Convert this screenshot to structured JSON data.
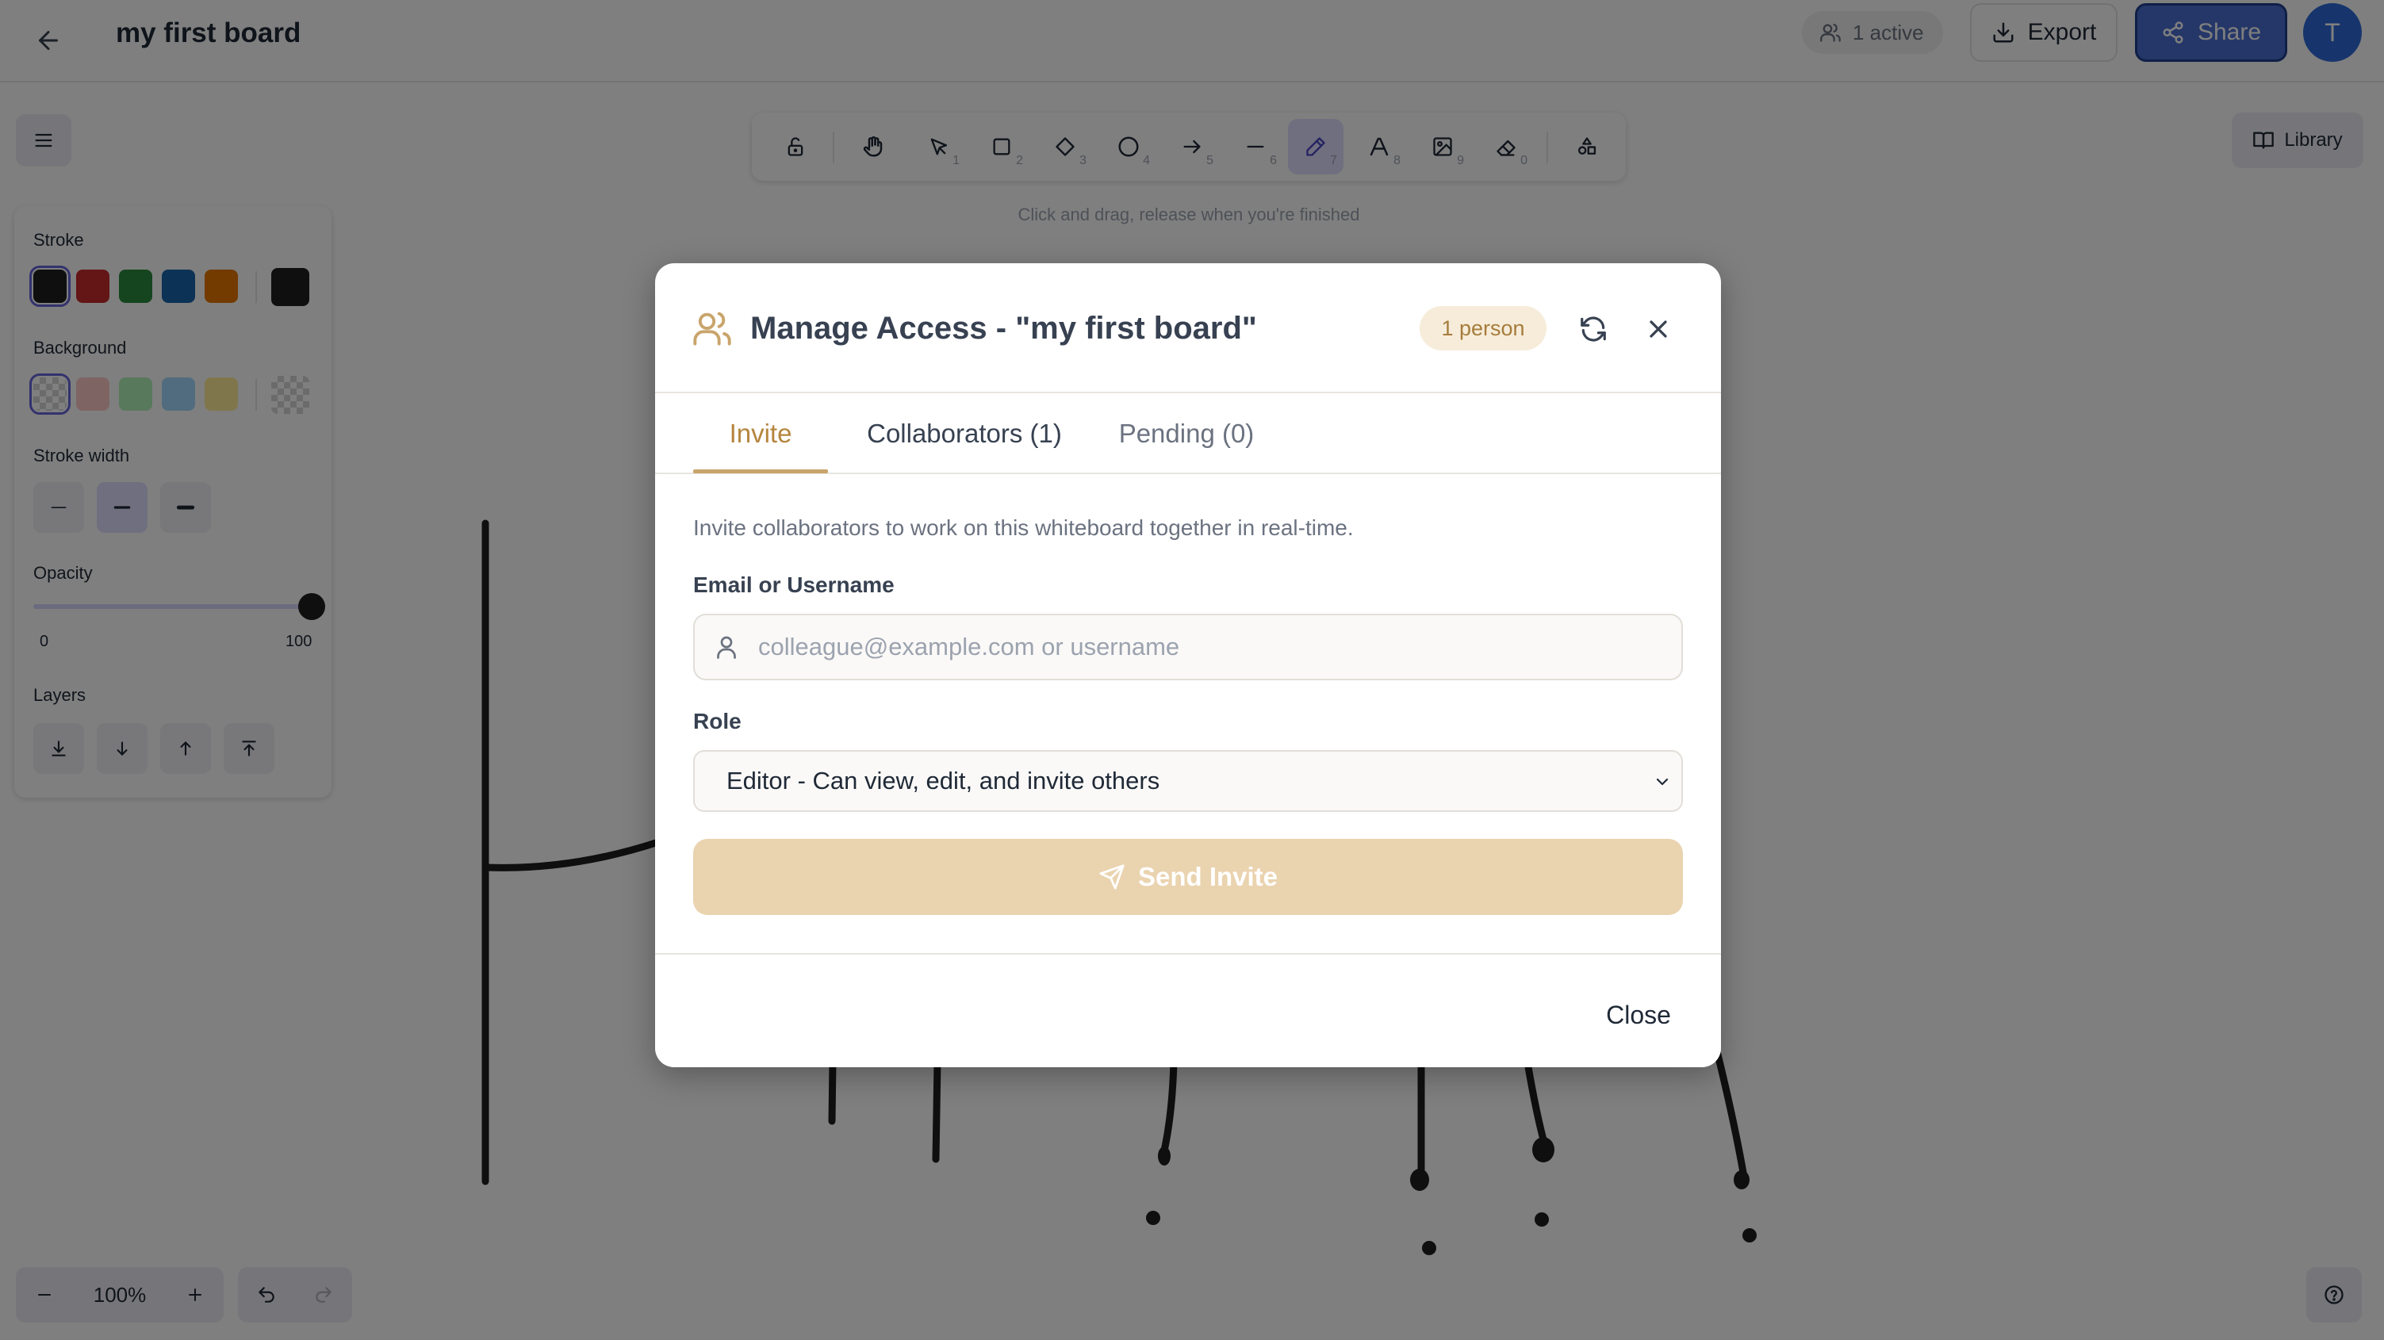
{
  "header": {
    "title": "my first board",
    "active_label": "1 active",
    "export_label": "Export",
    "share_label": "Share",
    "avatar_initial": "T"
  },
  "toolbar": {
    "tools": [
      {
        "name": "lock",
        "icon": "lock-icon",
        "shortcut": ""
      },
      {
        "name": "hand",
        "icon": "hand-icon",
        "shortcut": ""
      },
      {
        "name": "selection",
        "icon": "pointer-icon",
        "shortcut": "1"
      },
      {
        "name": "rectangle",
        "icon": "square-icon",
        "shortcut": "2"
      },
      {
        "name": "diamond",
        "icon": "diamond-icon",
        "shortcut": "3"
      },
      {
        "name": "ellipse",
        "icon": "circle-icon",
        "shortcut": "4"
      },
      {
        "name": "arrow",
        "icon": "arrow-right-icon",
        "shortcut": "5"
      },
      {
        "name": "line",
        "icon": "line-icon",
        "shortcut": "6"
      },
      {
        "name": "draw",
        "icon": "pencil-icon",
        "shortcut": "7",
        "active": true
      },
      {
        "name": "text",
        "icon": "text-icon",
        "shortcut": "8"
      },
      {
        "name": "image",
        "icon": "image-icon",
        "shortcut": "9"
      },
      {
        "name": "eraser",
        "icon": "eraser-icon",
        "shortcut": "0"
      },
      {
        "name": "extra-tools",
        "icon": "shapes-icon",
        "shortcut": ""
      }
    ],
    "hint": "Click and drag, release when you're finished"
  },
  "library_label": "Library",
  "properties": {
    "stroke_label": "Stroke",
    "stroke_colors": [
      "#1e1e1e",
      "#e03131",
      "#2f9e44",
      "#1971c2",
      "#f08c00"
    ],
    "stroke_current": "#1e1e1e",
    "background_label": "Background",
    "background_colors": [
      "transparent",
      "#ffc9c9",
      "#b2f2bb",
      "#a5d8ff",
      "#ffec99"
    ],
    "background_current": "transparent",
    "stroke_width_label": "Stroke width",
    "opacity_label": "Opacity",
    "opacity_min": "0",
    "opacity_max": "100",
    "opacity_value": 100,
    "layers_label": "Layers"
  },
  "zoom": {
    "value": "100%"
  },
  "modal": {
    "title": "Manage Access - \"my first board\"",
    "person_badge": "1 person",
    "tabs": [
      {
        "label": "Invite",
        "active": true
      },
      {
        "label": "Collaborators (1)"
      },
      {
        "label": "Pending (0)"
      }
    ],
    "description": "Invite collaborators to work on this whiteboard together in real-time.",
    "email_label": "Email or Username",
    "email_value": "",
    "email_placeholder": "colleague@example.com or username",
    "role_label": "Role",
    "role_selected": "Editor - Can view, edit, and invite others",
    "send_label": "Send Invite",
    "close_label": "Close"
  },
  "colors": {
    "accent": "#b5853e",
    "send_button_disabled": "#ead3af",
    "share_button": "#4a6fd0",
    "tool_active": "#e0dfff"
  }
}
